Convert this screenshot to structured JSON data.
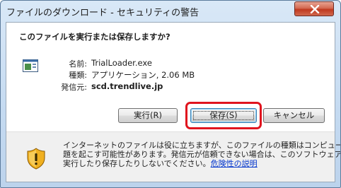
{
  "window": {
    "title": "ファイルのダウンロード - セキュリティの警告",
    "close_icon": "close-icon"
  },
  "dialog": {
    "question": "このファイルを実行または保存しますか?",
    "file_icon": "executable-file-icon",
    "fields": {
      "name_label": "名前:",
      "name_value": "TrialLoader.exe",
      "type_label": "種類:",
      "type_value": "アプリケーション, 2.06 MB",
      "from_label": "発信元:",
      "from_value": "scd.trendlive.jp"
    },
    "buttons": {
      "run": "実行(R)",
      "save": "保存(S)",
      "cancel": "キャンセル"
    },
    "highlight_color": "#e0141e"
  },
  "footer": {
    "warning_icon": "shield-warning-icon",
    "line1": "インターネットのファイルは役に立ちますが、このファイルの種類はコンピューターに問",
    "line2": "題を起こす可能性があります。発信元が信頼できない場合は、このソフトウェアを",
    "line3": "実行したり保存したりしないでください。",
    "link": "危険性の説明"
  }
}
